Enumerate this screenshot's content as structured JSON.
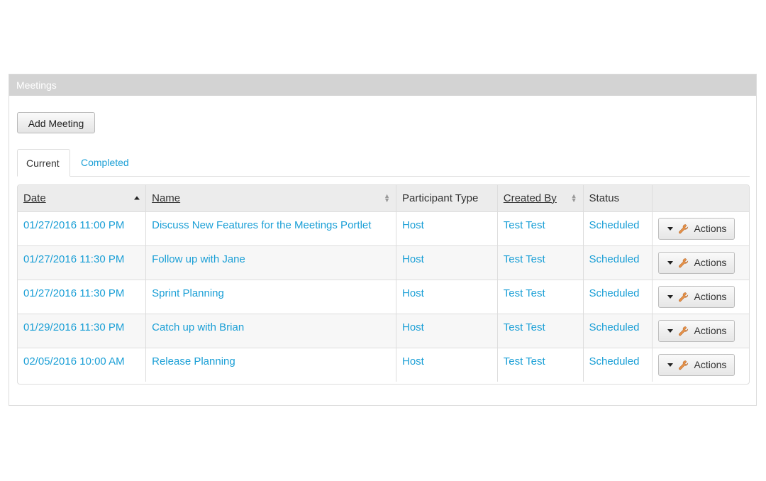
{
  "portlet": {
    "title": "Meetings",
    "add_button_label": "Add Meeting"
  },
  "tabs": [
    {
      "label": "Current",
      "active": true
    },
    {
      "label": "Completed",
      "active": false
    }
  ],
  "table": {
    "columns": [
      "Date",
      "Name",
      "Participant Type",
      "Created By",
      "Status",
      ""
    ],
    "rows": [
      {
        "date": "01/27/2016 11:00 PM",
        "name": "Discuss New Features for the Meetings Portlet",
        "participant_type": "Host",
        "created_by": "Test Test",
        "status": "Scheduled",
        "action": "Actions"
      },
      {
        "date": "01/27/2016 11:30 PM",
        "name": "Follow up with Jane",
        "participant_type": "Host",
        "created_by": "Test Test",
        "status": "Scheduled",
        "action": "Actions"
      },
      {
        "date": "01/27/2016 11:30 PM",
        "name": "Sprint Planning",
        "participant_type": "Host",
        "created_by": "Test Test",
        "status": "Scheduled",
        "action": "Actions"
      },
      {
        "date": "01/29/2016 11:30 PM",
        "name": "Catch up with Brian",
        "participant_type": "Host",
        "created_by": "Test Test",
        "status": "Scheduled",
        "action": "Actions"
      },
      {
        "date": "02/05/2016 10:00 AM",
        "name": "Release Planning",
        "participant_type": "Host",
        "created_by": "Test Test",
        "status": "Scheduled",
        "action": "Actions"
      }
    ]
  },
  "colors": {
    "link": "#1a9fd6",
    "header_bar": "#d3d3d3",
    "table_header": "#ececec"
  },
  "icons": {
    "sort_ascending": "caret-up-icon",
    "sort_both": "sort-icon",
    "dropdown": "caret-down-icon",
    "actions": "wrench-icon"
  }
}
